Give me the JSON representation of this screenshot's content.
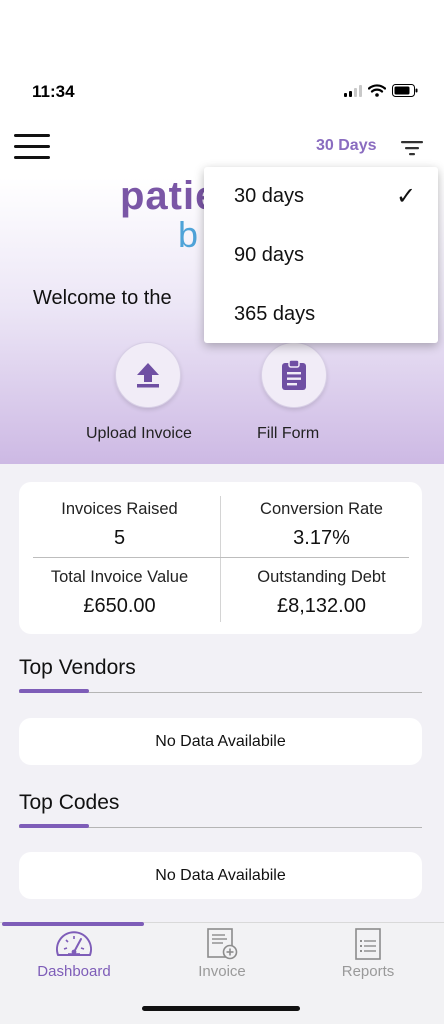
{
  "status_bar": {
    "time": "11:34"
  },
  "header": {
    "period": "30 Days",
    "menu_icon": "hamburger-menu-icon",
    "filter_icon": "filter-lines-icon"
  },
  "logo": {
    "top": "patie",
    "bottom": "b"
  },
  "welcome_text": "Welcome to the",
  "actions": [
    {
      "label": "Upload Invoice",
      "icon": "upload-icon"
    },
    {
      "label": "Fill Form",
      "icon": "clipboard-icon"
    }
  ],
  "stats": [
    {
      "label": "Invoices Raised",
      "value": "5"
    },
    {
      "label": "Conversion Rate",
      "value": "3.17%"
    },
    {
      "label": "Total Invoice Value",
      "value": "£650.00"
    },
    {
      "label": "Outstanding Debt",
      "value": "£8,132.00"
    }
  ],
  "sections": [
    {
      "title": "Top Vendors",
      "empty_text": "No Data Availabile"
    },
    {
      "title": "Top Codes",
      "empty_text": "No Data Availabile"
    }
  ],
  "tabs": [
    {
      "label": "Dashboard",
      "icon": "speedometer-icon",
      "active": true
    },
    {
      "label": "Invoice",
      "icon": "add-invoice-icon",
      "active": false
    },
    {
      "label": "Reports",
      "icon": "report-list-icon",
      "active": false
    }
  ],
  "dropdown": {
    "options": [
      {
        "label": "30 days",
        "selected": true
      },
      {
        "label": "90 days",
        "selected": false
      },
      {
        "label": "365 days",
        "selected": false
      }
    ],
    "check_mark": "✓"
  },
  "colors": {
    "accent": "#7e5db8",
    "period_text": "#8a6cc0",
    "logo_purple": "#7a56a6",
    "logo_blue": "#4fa3d8"
  }
}
